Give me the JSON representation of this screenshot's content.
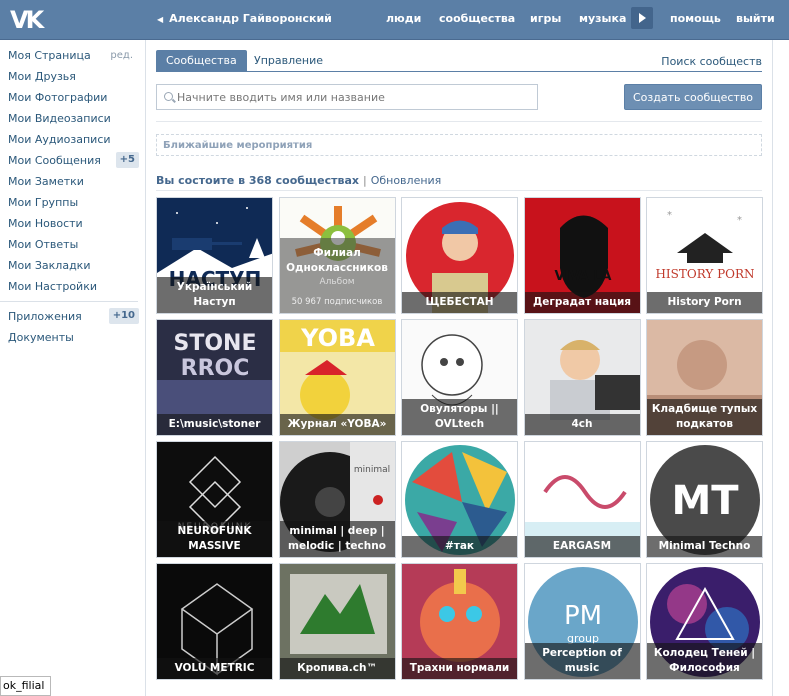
{
  "header": {
    "logo": "VK",
    "user_name": "Александр Гайворонский",
    "nav": [
      "люди",
      "сообщества",
      "игры",
      "музыка",
      "помощь",
      "выйти"
    ]
  },
  "sidebar": {
    "items": [
      {
        "label": "Моя Страница",
        "extra": "ред."
      },
      {
        "label": "Мои Друзья"
      },
      {
        "label": "Мои Фотографии"
      },
      {
        "label": "Мои Видеозаписи"
      },
      {
        "label": "Мои Аудиозаписи"
      },
      {
        "label": "Мои Сообщения",
        "badge": "+5"
      },
      {
        "label": "Мои Заметки"
      },
      {
        "label": "Мои Группы"
      },
      {
        "label": "Мои Новости"
      },
      {
        "label": "Мои Ответы"
      },
      {
        "label": "Мои Закладки"
      },
      {
        "label": "Мои Настройки"
      }
    ],
    "extra_items": [
      {
        "label": "Приложения",
        "badge": "+10"
      },
      {
        "label": "Документы"
      }
    ]
  },
  "tabs": [
    "Сообщества",
    "Управление"
  ],
  "search_link": "Поиск сообществ",
  "search": {
    "placeholder": "Начните вводить имя или название",
    "value": ""
  },
  "create_button": "Создать сообщество",
  "events_label": "Ближайшие мероприятия",
  "groups_header": {
    "title": "Вы состоите в 368 сообществах",
    "separator": "|",
    "updates": "Обновления"
  },
  "groups": [
    {
      "name": "Український Наступ",
      "art": "tank"
    },
    {
      "name": "Филиал Одноклассников",
      "art": "ok",
      "hovered": true,
      "hover_type": "Альбом",
      "subscribers": "50 967 подписчиков"
    },
    {
      "name": "ЩЕБЕСТАН",
      "art": "boy"
    },
    {
      "name": "Деградат нация",
      "art": "che"
    },
    {
      "name": "History Porn",
      "art": "history"
    },
    {
      "name": "E:\\music\\stoner",
      "art": "stoner"
    },
    {
      "name": "Журнал «YOBA»",
      "art": "yoba"
    },
    {
      "name": "Овуляторы || OVLtech",
      "art": "sketch"
    },
    {
      "name": "4ch",
      "art": "kid"
    },
    {
      "name": "Кладбище тупых подкатов",
      "art": "cat"
    },
    {
      "name": "NEUROFUNK MASSIVE",
      "art": "neuro"
    },
    {
      "name": "minimal | deep | melodic | techno",
      "art": "vinyl"
    },
    {
      "name": "#так",
      "art": "triangles"
    },
    {
      "name": "EARGASM",
      "art": "eargasm"
    },
    {
      "name": "Minimal Techno",
      "art": "mt"
    },
    {
      "name": "VOLU METRIC",
      "art": "cube"
    },
    {
      "name": "Кропива.ch™",
      "art": "kropiva"
    },
    {
      "name": "Трахни нормали",
      "art": "face"
    },
    {
      "name": "Perception of music",
      "art": "pm"
    },
    {
      "name": "Колодец Теней | Философия",
      "art": "galaxy"
    }
  ],
  "tooltip": "ok_filial",
  "colors": {
    "header": "#5b7fa6",
    "link": "#2b587a",
    "accent": "#45688e"
  }
}
